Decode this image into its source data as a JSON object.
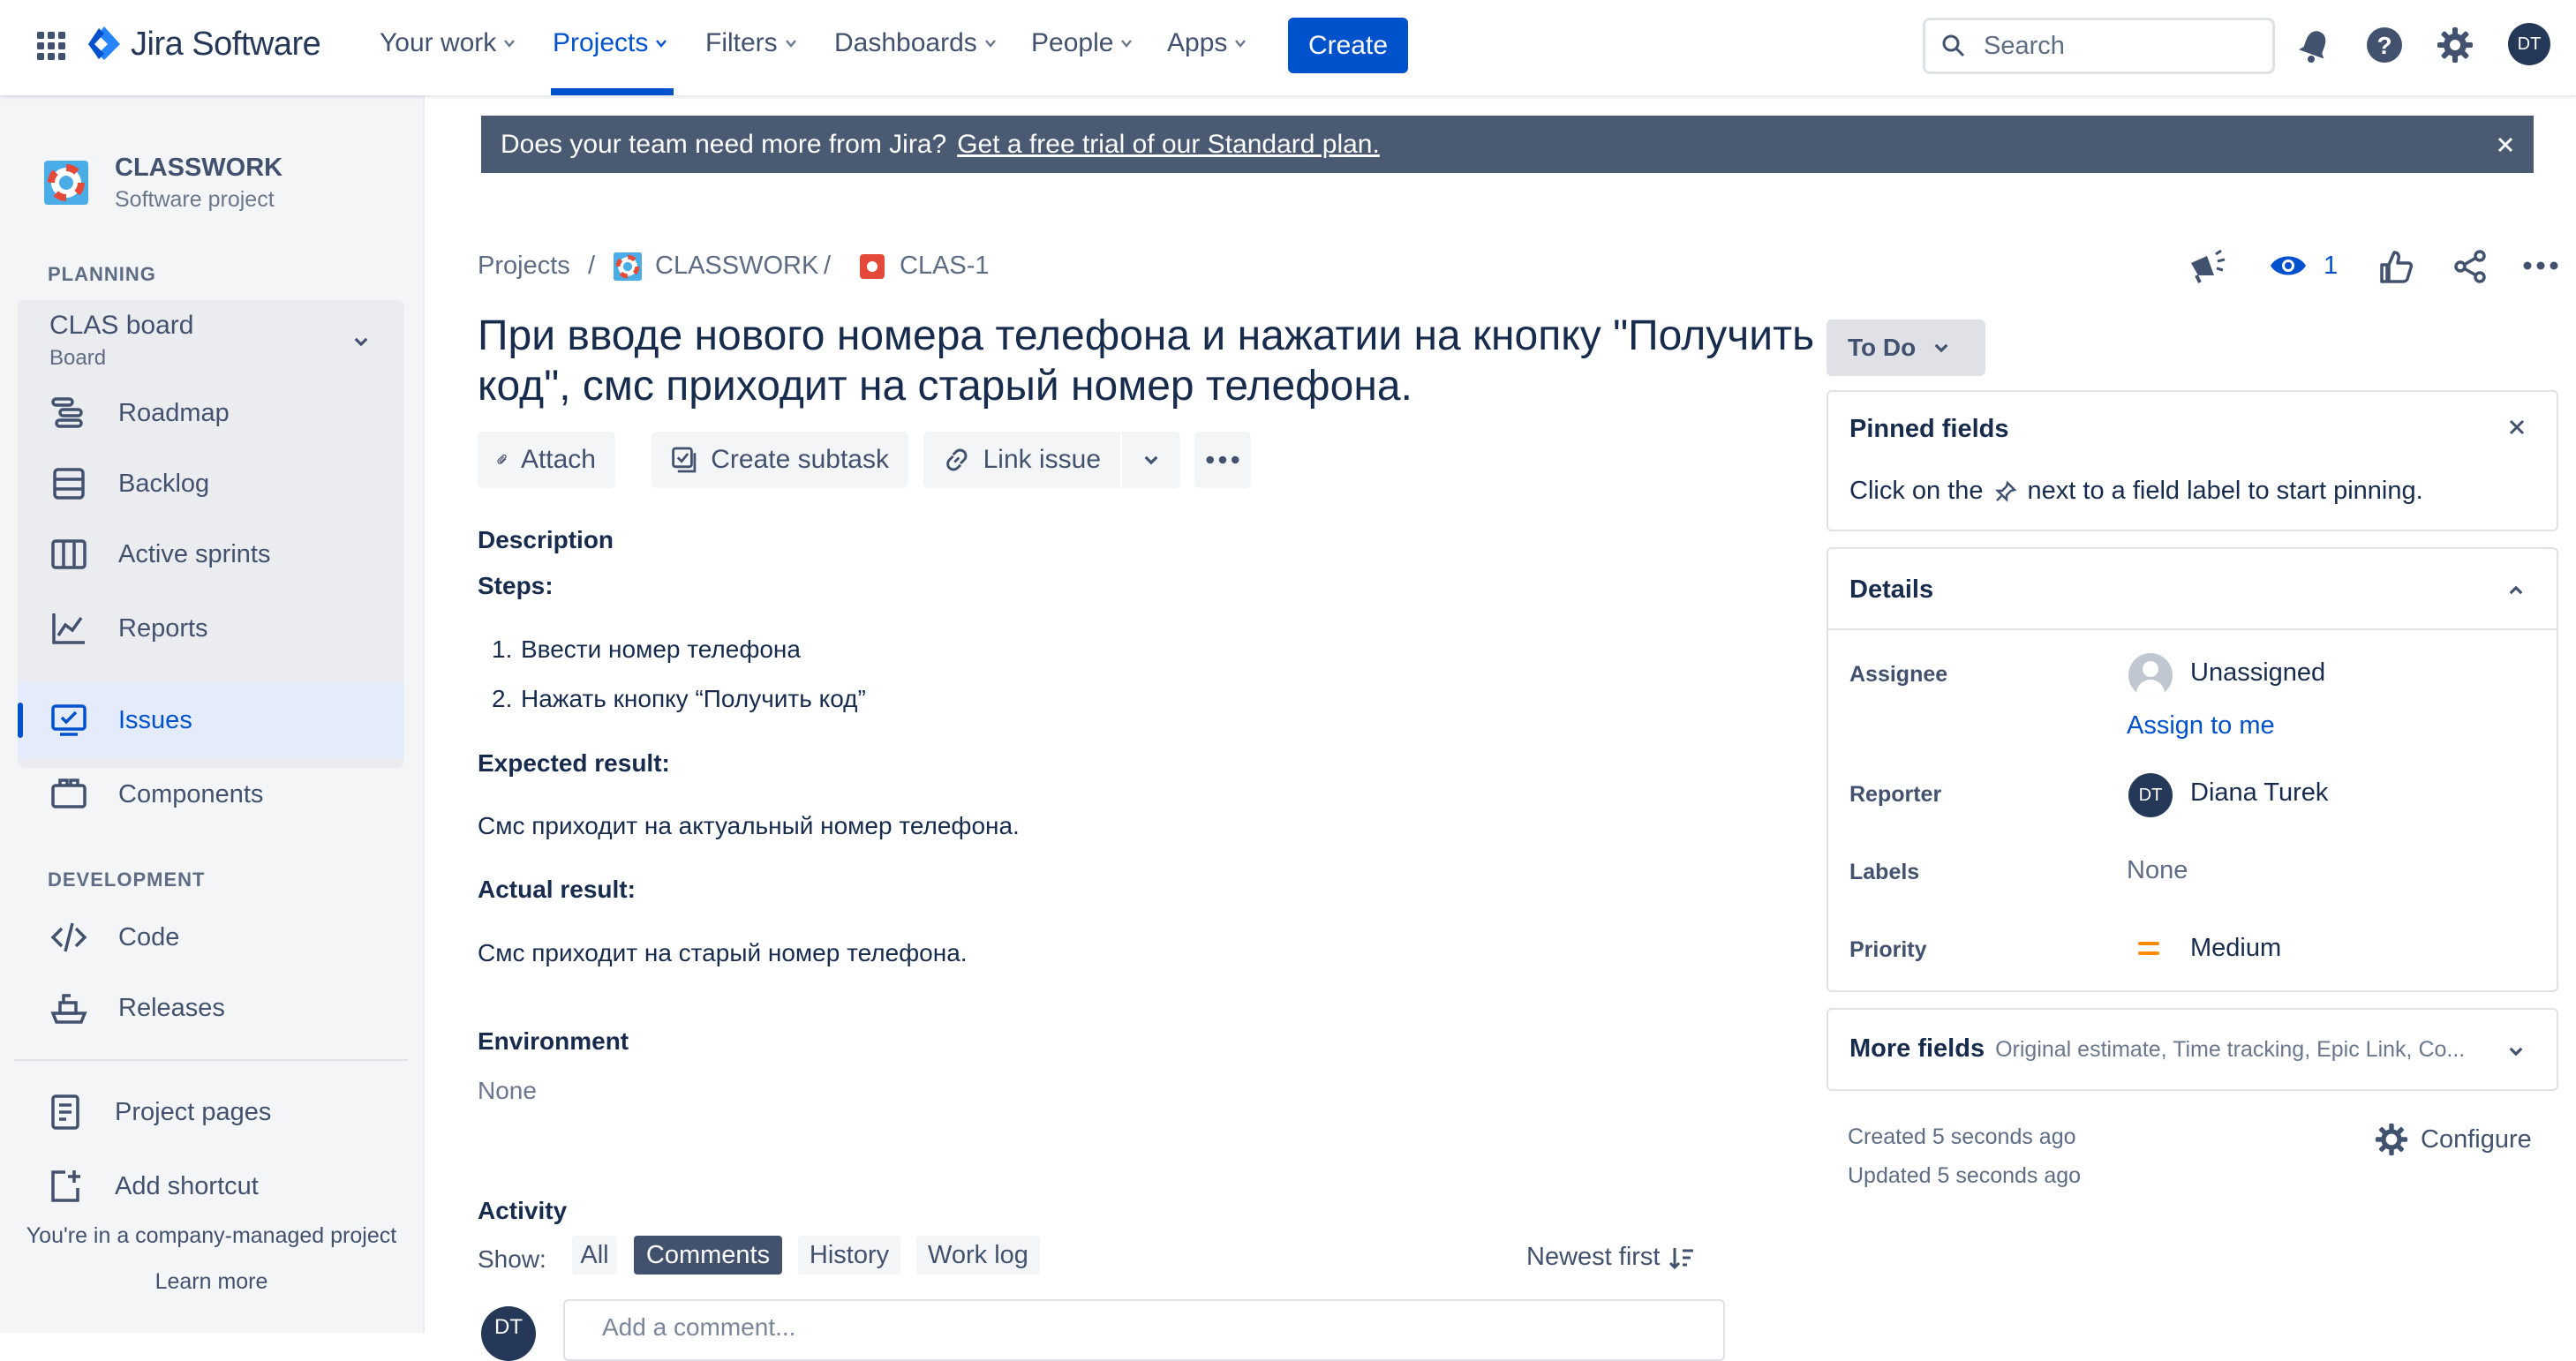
{
  "app": {
    "name": "Jira Software"
  },
  "nav": {
    "your_work": "Your work",
    "projects": "Projects",
    "filters": "Filters",
    "dashboards": "Dashboards",
    "people": "People",
    "apps": "Apps",
    "create": "Create",
    "search_placeholder": "Search",
    "avatar_initials": "DT"
  },
  "sidebar": {
    "project_name": "CLASSWORK",
    "project_type": "Software project",
    "planning_label": "PLANNING",
    "board_name": "CLAS board",
    "board_sub": "Board",
    "planning_items": [
      "Roadmap",
      "Backlog",
      "Active sprints",
      "Reports"
    ],
    "issues": "Issues",
    "components": "Components",
    "development_label": "DEVELOPMENT",
    "code": "Code",
    "releases": "Releases",
    "project_pages": "Project pages",
    "add_shortcut": "Add shortcut",
    "company_managed": "You're in a company-managed project",
    "learn_more": "Learn more"
  },
  "banner": {
    "text": "Does your team need more from Jira?",
    "link": "Get a free trial of our Standard plan."
  },
  "breadcrumb": {
    "projects": "Projects",
    "project": "CLASSWORK",
    "issue_key": "CLAS-1"
  },
  "issue": {
    "title": "При вводе нового номера телефона и нажатии на кнопку \"Получить код\", смс приходит на старый номер телефона.",
    "watchers": "1",
    "actions": {
      "attach": "Attach",
      "create_subtask": "Create subtask",
      "link_issue": "Link issue"
    },
    "description_label": "Description",
    "steps_label": "Steps:",
    "steps": [
      "Ввести номер телефона",
      "Нажать кнопку “Получить код”"
    ],
    "expected_label": "Expected result:",
    "expected": "Смс приходит на актуальный номер телефона.",
    "actual_label": "Actual result:",
    "actual": "Смс приходит на старый номер телефона.",
    "environment_label": "Environment",
    "environment_value": "None",
    "activity_label": "Activity",
    "show_label": "Show:",
    "activity_tabs": [
      "All",
      "Comments",
      "History",
      "Work log"
    ],
    "sort": "Newest first",
    "comment_placeholder": "Add a comment..."
  },
  "right_panel": {
    "status": "To Do",
    "pinned_title": "Pinned fields",
    "pinned_text_a": "Click on the",
    "pinned_text_b": "next to a field label to start pinning.",
    "details_title": "Details",
    "assignee_label": "Assignee",
    "assignee_value": "Unassigned",
    "assign_to_me": "Assign to me",
    "reporter_label": "Reporter",
    "reporter_value": "Diana Turek",
    "reporter_initials": "DT",
    "labels_label": "Labels",
    "labels_value": "None",
    "priority_label": "Priority",
    "priority_value": "Medium",
    "more_fields": "More fields",
    "more_fields_hint": "Original estimate, Time tracking, Epic Link, Co...",
    "created": "Created 5 seconds ago",
    "updated": "Updated 5 seconds ago",
    "configure": "Configure"
  },
  "colors": {
    "brand": "#0052cc",
    "banner": "#4a5a73",
    "priority_medium": "#ff8b00",
    "issue_type": "#e5493a"
  }
}
